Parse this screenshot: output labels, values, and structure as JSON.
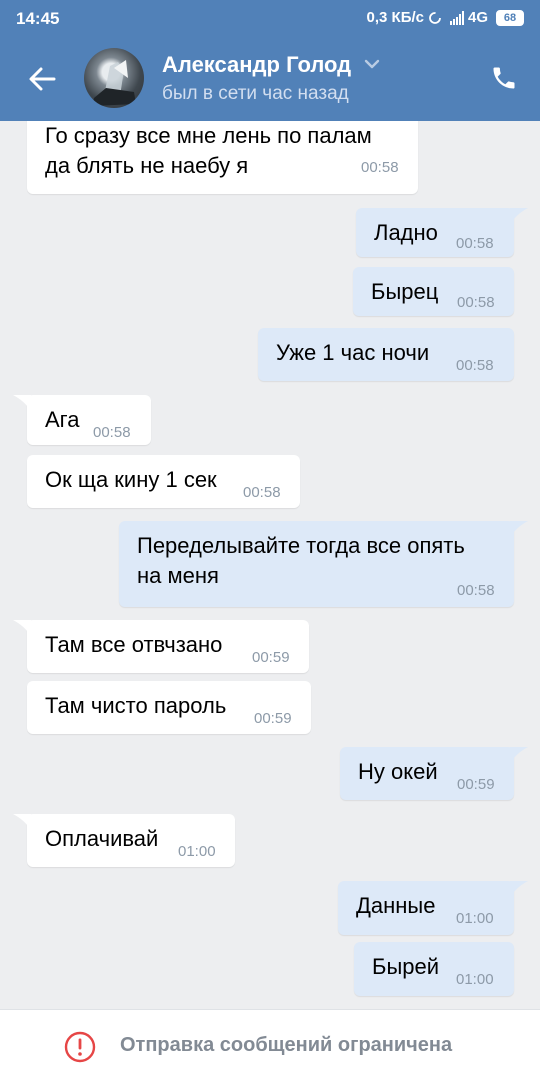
{
  "status_bar": {
    "time": "14:45",
    "speed": "0,3 КБ/с",
    "network": "4G",
    "battery": "68"
  },
  "header": {
    "contact_name": "Александр Голод",
    "last_seen": "был в сети час назад",
    "accent_color": "#5181b8"
  },
  "messages": [
    {
      "dir": "in",
      "lines": [
        "Го сразу все мне лень по палам",
        "да блять не наебу я"
      ],
      "time": "00:58"
    },
    {
      "dir": "out",
      "lines": [
        "Ладно"
      ],
      "time": "00:58"
    },
    {
      "dir": "out",
      "lines": [
        "Бырец"
      ],
      "time": "00:58"
    },
    {
      "dir": "out",
      "lines": [
        "Уже 1 час ночи"
      ],
      "time": "00:58"
    },
    {
      "dir": "in",
      "lines": [
        "Ага"
      ],
      "time": "00:58"
    },
    {
      "dir": "in",
      "lines": [
        "Ок ща кину 1 сек"
      ],
      "time": "00:58"
    },
    {
      "dir": "out",
      "lines": [
        "Переделывайте тогда все опять",
        "на меня"
      ],
      "time": "00:58"
    },
    {
      "dir": "in",
      "lines": [
        "Там все отвчзано"
      ],
      "time": "00:59"
    },
    {
      "dir": "in",
      "lines": [
        "Там чисто пароль"
      ],
      "time": "00:59"
    },
    {
      "dir": "out",
      "lines": [
        "Ну окей"
      ],
      "time": "00:59"
    },
    {
      "dir": "in",
      "lines": [
        "Оплачивай"
      ],
      "time": "01:00"
    },
    {
      "dir": "out",
      "lines": [
        "Данные"
      ],
      "time": "01:00"
    },
    {
      "dir": "out",
      "lines": [
        "Бырей"
      ],
      "time": "01:00"
    }
  ],
  "bottom": {
    "restriction_text": "Отправка сообщений ограничена"
  }
}
